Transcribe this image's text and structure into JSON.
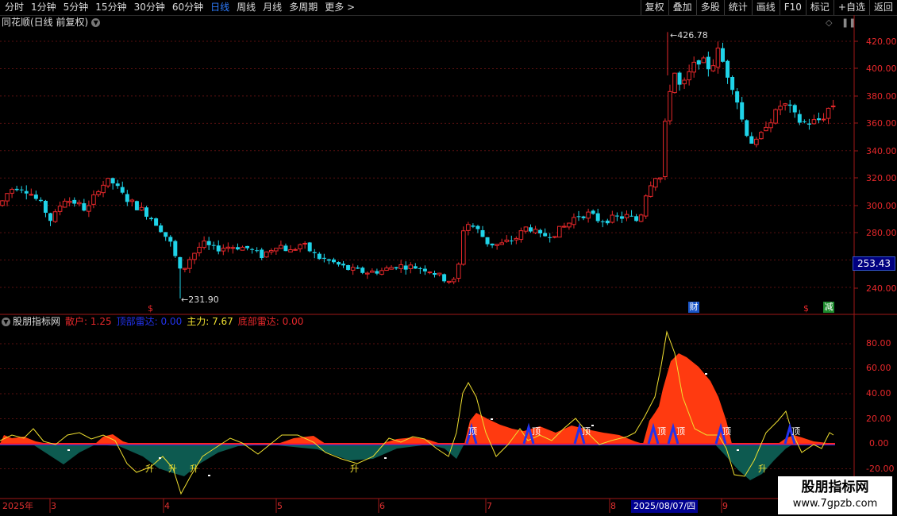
{
  "toolbar": {
    "periods": [
      "分时",
      "1分钟",
      "5分钟",
      "15分钟",
      "30分钟",
      "60分钟",
      "日线",
      "周线",
      "月线",
      "多周期",
      "更多 >"
    ],
    "active_period": "日线",
    "right_buttons": [
      "复权",
      "叠加",
      "多股",
      "统计",
      "画线",
      "F10",
      "标记",
      "+自选",
      "返回"
    ]
  },
  "main_panel": {
    "title": "同花顺(日线 前复权)",
    "collapse_icon": "chevron-down-icon",
    "corner_icons": [
      "diamond-icon",
      "pause-icon"
    ],
    "high_label": "426.78",
    "low_label": "231.90",
    "current_price": "253.43",
    "y_ticks": [
      "420.00",
      "400.00",
      "380.00",
      "360.00",
      "340.00",
      "320.00",
      "300.00",
      "280.00",
      "260.00",
      "240.00"
    ],
    "badges": [
      {
        "text": "$",
        "color": "#e8282b"
      },
      {
        "text": "财",
        "color": "#2a7fff"
      },
      {
        "text": "$",
        "color": "#e8282b"
      },
      {
        "text": "减",
        "color": "#2fbf3f"
      }
    ]
  },
  "indicator_panel": {
    "name": "股朋指标网",
    "legend": [
      {
        "label": "散户:",
        "value": "1.25",
        "color": "#e8282b"
      },
      {
        "label": "顶部雷达:",
        "value": "0.00",
        "color": "#2233ee"
      },
      {
        "label": "主力:",
        "value": "7.67",
        "color": "#f0e030"
      },
      {
        "label": "底部雷达:",
        "value": "0.00",
        "color": "#e8282b"
      }
    ],
    "y_ticks": [
      "80.00",
      "60.00",
      "40.00",
      "20.00",
      "0.00",
      "-20.00"
    ],
    "top_marker": "顶",
    "rise_marker": "升"
  },
  "date_axis": {
    "labels": [
      "2025年",
      "3",
      "4",
      "5",
      "6",
      "7",
      "8",
      "9"
    ],
    "highlighted_date": "2025/08/07/四"
  },
  "watermark": {
    "line1": "股朋指标网",
    "line2": "www.7gpzb.com"
  },
  "colors": {
    "up": "#e8282b",
    "down": "#1fd3e8",
    "grid": "#5a1010",
    "axis": "#a01818"
  }
}
